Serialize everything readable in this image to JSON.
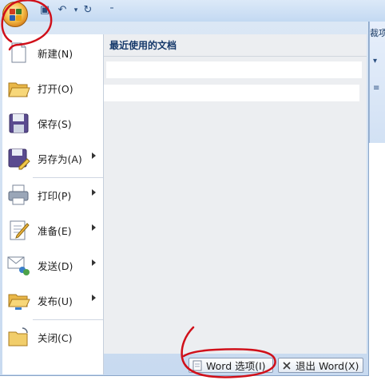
{
  "ribbon": {
    "tab_label": "裁项"
  },
  "quick_access": {
    "icons": [
      "save-icon",
      "undo-icon",
      "redo-icon",
      "customize-icon"
    ]
  },
  "office_button": {
    "icon": "office-logo-icon"
  },
  "menu": {
    "items": [
      {
        "label": "新建(N)",
        "icon": "new-document-icon",
        "has_submenu": false
      },
      {
        "label": "打开(O)",
        "icon": "open-folder-icon",
        "has_submenu": false
      },
      {
        "label": "保存(S)",
        "icon": "save-floppy-icon",
        "has_submenu": false
      },
      {
        "label": "另存为(A)",
        "icon": "save-as-icon",
        "has_submenu": true
      },
      {
        "label": "打印(P)",
        "icon": "printer-icon",
        "has_submenu": true
      },
      {
        "label": "准备(E)",
        "icon": "prepare-icon",
        "has_submenu": true
      },
      {
        "label": "发送(D)",
        "icon": "send-icon",
        "has_submenu": true
      },
      {
        "label": "发布(U)",
        "icon": "publish-icon",
        "has_submenu": true
      },
      {
        "label": "关闭(C)",
        "icon": "close-folder-icon",
        "has_submenu": false
      }
    ]
  },
  "recent": {
    "header": "最近使用的文档",
    "items": [
      "",
      ""
    ]
  },
  "footer": {
    "options_label": "Word 选项(I)",
    "exit_label": "退出 Word(X)"
  },
  "colors": {
    "annotation": "#d0101a",
    "menu_bg": "#d4e3f4",
    "header_text": "#15386a"
  }
}
